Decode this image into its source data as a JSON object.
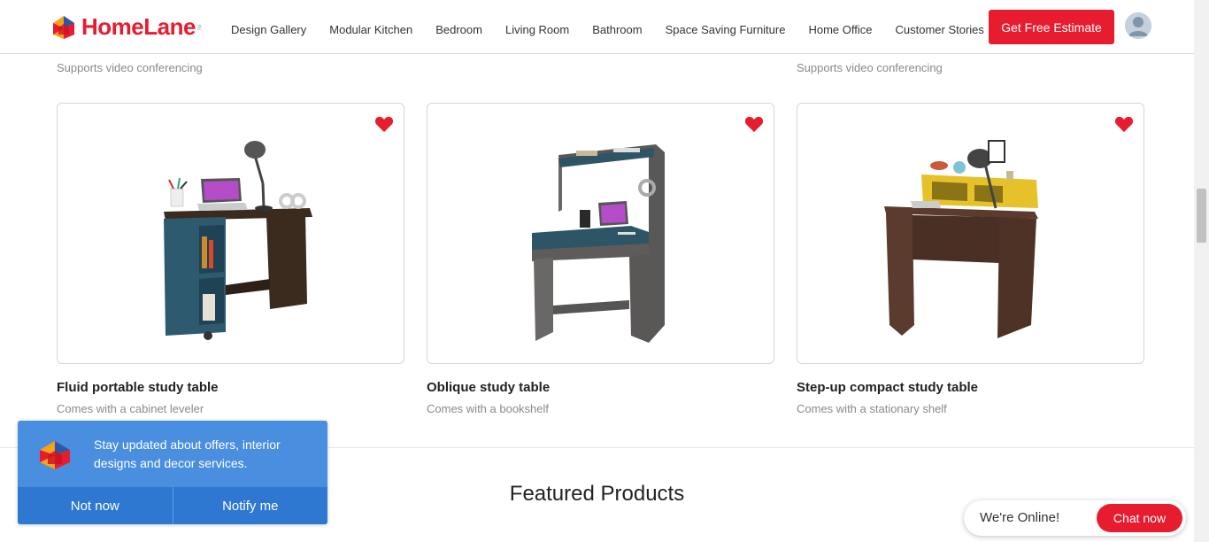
{
  "header": {
    "logo_text": "HomeLane",
    "logo_tm": "TM",
    "nav": [
      "Design Gallery",
      "Modular Kitchen",
      "Bedroom",
      "Living Room",
      "Bathroom",
      "Space Saving Furniture",
      "Home Office",
      "Customer Stories"
    ],
    "cta_label": "Get Free Estimate",
    "accent_color": "#e71c2f"
  },
  "previous_row": {
    "left_subtitle": "Supports video conferencing",
    "right_subtitle": "Supports video conferencing"
  },
  "products": [
    {
      "title": "Fluid portable study table",
      "subtitle": "Comes with a cabinet leveler",
      "icon": "heart-icon"
    },
    {
      "title": "Oblique study table",
      "subtitle": "Comes with a bookshelf",
      "icon": "heart-icon"
    },
    {
      "title": "Step-up compact study table",
      "subtitle": "Comes with a stationary shelf",
      "icon": "heart-icon"
    }
  ],
  "featured": {
    "title": "Featured Products"
  },
  "notify": {
    "message": "Stay updated about offers, interior designs and decor services.",
    "dismiss_label": "Not now",
    "accept_label": "Notify me"
  },
  "chat": {
    "status": "We're Online!",
    "button_label": "Chat now"
  }
}
